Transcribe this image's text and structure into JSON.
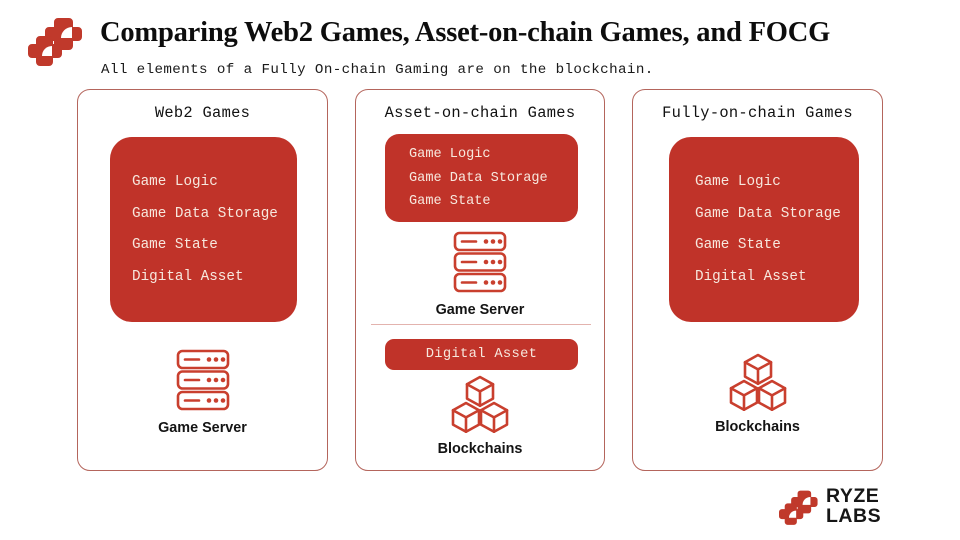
{
  "header": {
    "logo_icon": "ryze-logo-mark",
    "title": "Comparing Web2 Games, Asset-on-chain Games, and FOCG",
    "subtitle": "All elements of a Fully On-chain Gaming are on the blockchain."
  },
  "colors": {
    "brand_red": "#c03329",
    "panel_text": "#f7e8de",
    "card_border": "#b4655c",
    "icon_red": "#c93f2e",
    "divider": "#e3b3ae",
    "background": "#ffffff",
    "title_text": "#0d0d0d"
  },
  "cards": [
    {
      "title": "Web2 Games",
      "panel_elements": [
        "Game Logic",
        "Game Data Storage",
        "Game State",
        "Digital Asset"
      ],
      "has_divider": false,
      "asset_pill": null,
      "icons": [
        {
          "icon": "server-icon",
          "caption": "Game Server"
        }
      ]
    },
    {
      "title": "Asset-on-chain Games",
      "panel_elements": [
        "Game Logic",
        "Game Data Storage",
        "Game State"
      ],
      "has_divider": true,
      "asset_pill": "Digital Asset",
      "icons": [
        {
          "icon": "server-icon",
          "caption": "Game Server"
        },
        {
          "icon": "blockchain-cubes-icon",
          "caption": "Blockchains"
        }
      ]
    },
    {
      "title": "Fully-on-chain Games",
      "panel_elements": [
        "Game Logic",
        "Game Data Storage",
        "Game State",
        "Digital Asset"
      ],
      "has_divider": false,
      "asset_pill": null,
      "icons": [
        {
          "icon": "blockchain-cubes-icon",
          "caption": "Blockchains"
        }
      ]
    }
  ],
  "footer": {
    "logo_icon": "ryze-logo-mark",
    "wordmark_line1": "RYZE",
    "wordmark_line2": "LABS"
  }
}
